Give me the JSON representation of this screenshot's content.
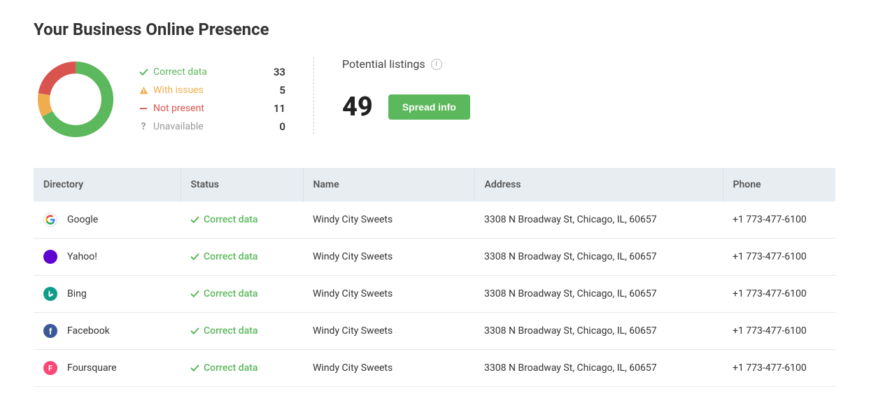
{
  "title": "Your Business Online Presence",
  "legend": {
    "correct": {
      "label": "Correct data",
      "value": "33"
    },
    "issues": {
      "label": "With issues",
      "value": "5"
    },
    "notpresent": {
      "label": "Not present",
      "value": "11"
    },
    "unavailable": {
      "label": "Unavailable",
      "value": "0"
    }
  },
  "chart_data": {
    "type": "pie",
    "title": "",
    "categories": [
      "Correct data",
      "With issues",
      "Not present",
      "Unavailable"
    ],
    "values": [
      33,
      5,
      11,
      0
    ],
    "colors": [
      "#5cb85c",
      "#f0ad4e",
      "#d9534f",
      "#cccccc"
    ]
  },
  "potential": {
    "label": "Potential listings",
    "count": "49",
    "button": "Spread info"
  },
  "table": {
    "headers": {
      "directory": "Directory",
      "status": "Status",
      "name": "Name",
      "address": "Address",
      "phone": "Phone"
    },
    "rows": [
      {
        "dir": "Google",
        "icon": "google",
        "status": "Correct data",
        "name": "Windy City Sweets",
        "address": "3308 N Broadway St, Chicago, IL, 60657",
        "phone": "+1 773-477-6100"
      },
      {
        "dir": "Yahoo!",
        "icon": "yahoo",
        "status": "Correct data",
        "name": "Windy City Sweets",
        "address": "3308 N Broadway St, Chicago, IL, 60657",
        "phone": "+1 773-477-6100"
      },
      {
        "dir": "Bing",
        "icon": "bing",
        "status": "Correct data",
        "name": "Windy City Sweets",
        "address": "3308 N Broadway St, Chicago, IL, 60657",
        "phone": "+1 773-477-6100"
      },
      {
        "dir": "Facebook",
        "icon": "facebook",
        "status": "Correct data",
        "name": "Windy City Sweets",
        "address": "3308 N Broadway St, Chicago, IL, 60657",
        "phone": "+1 773-477-6100"
      },
      {
        "dir": "Foursquare",
        "icon": "foursquare",
        "status": "Correct data",
        "name": "Windy City Sweets",
        "address": "3308 N Broadway St, Chicago, IL, 60657",
        "phone": "+1 773-477-6100"
      }
    ]
  }
}
